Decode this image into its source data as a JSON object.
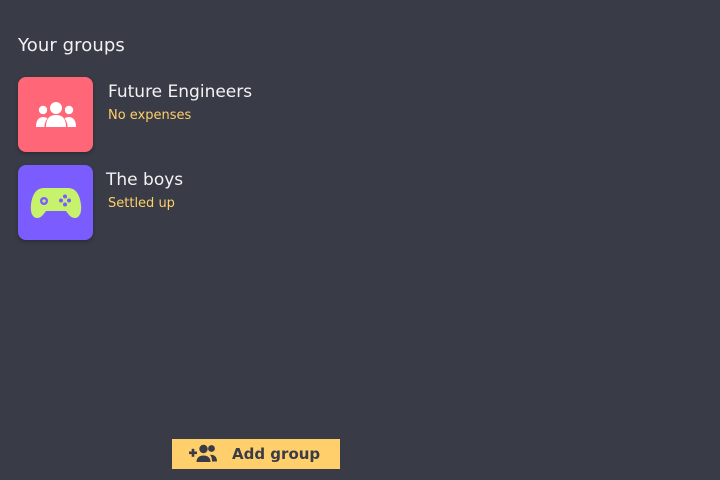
{
  "colors": {
    "background": "#393c46",
    "accent": "#ffcf6b",
    "status_text": "#ffcf6b"
  },
  "section_title": "Your groups",
  "groups": [
    {
      "name": "Future Engineers",
      "status": "No expenses",
      "icon": "people-group-icon",
      "avatar_color": "#ff6677"
    },
    {
      "name": "The boys",
      "status": "Settled up",
      "icon": "gamepad-icon",
      "avatar_color": "#7b5cff"
    }
  ],
  "add_group": {
    "label": "Add group",
    "icon": "add-group-icon"
  }
}
